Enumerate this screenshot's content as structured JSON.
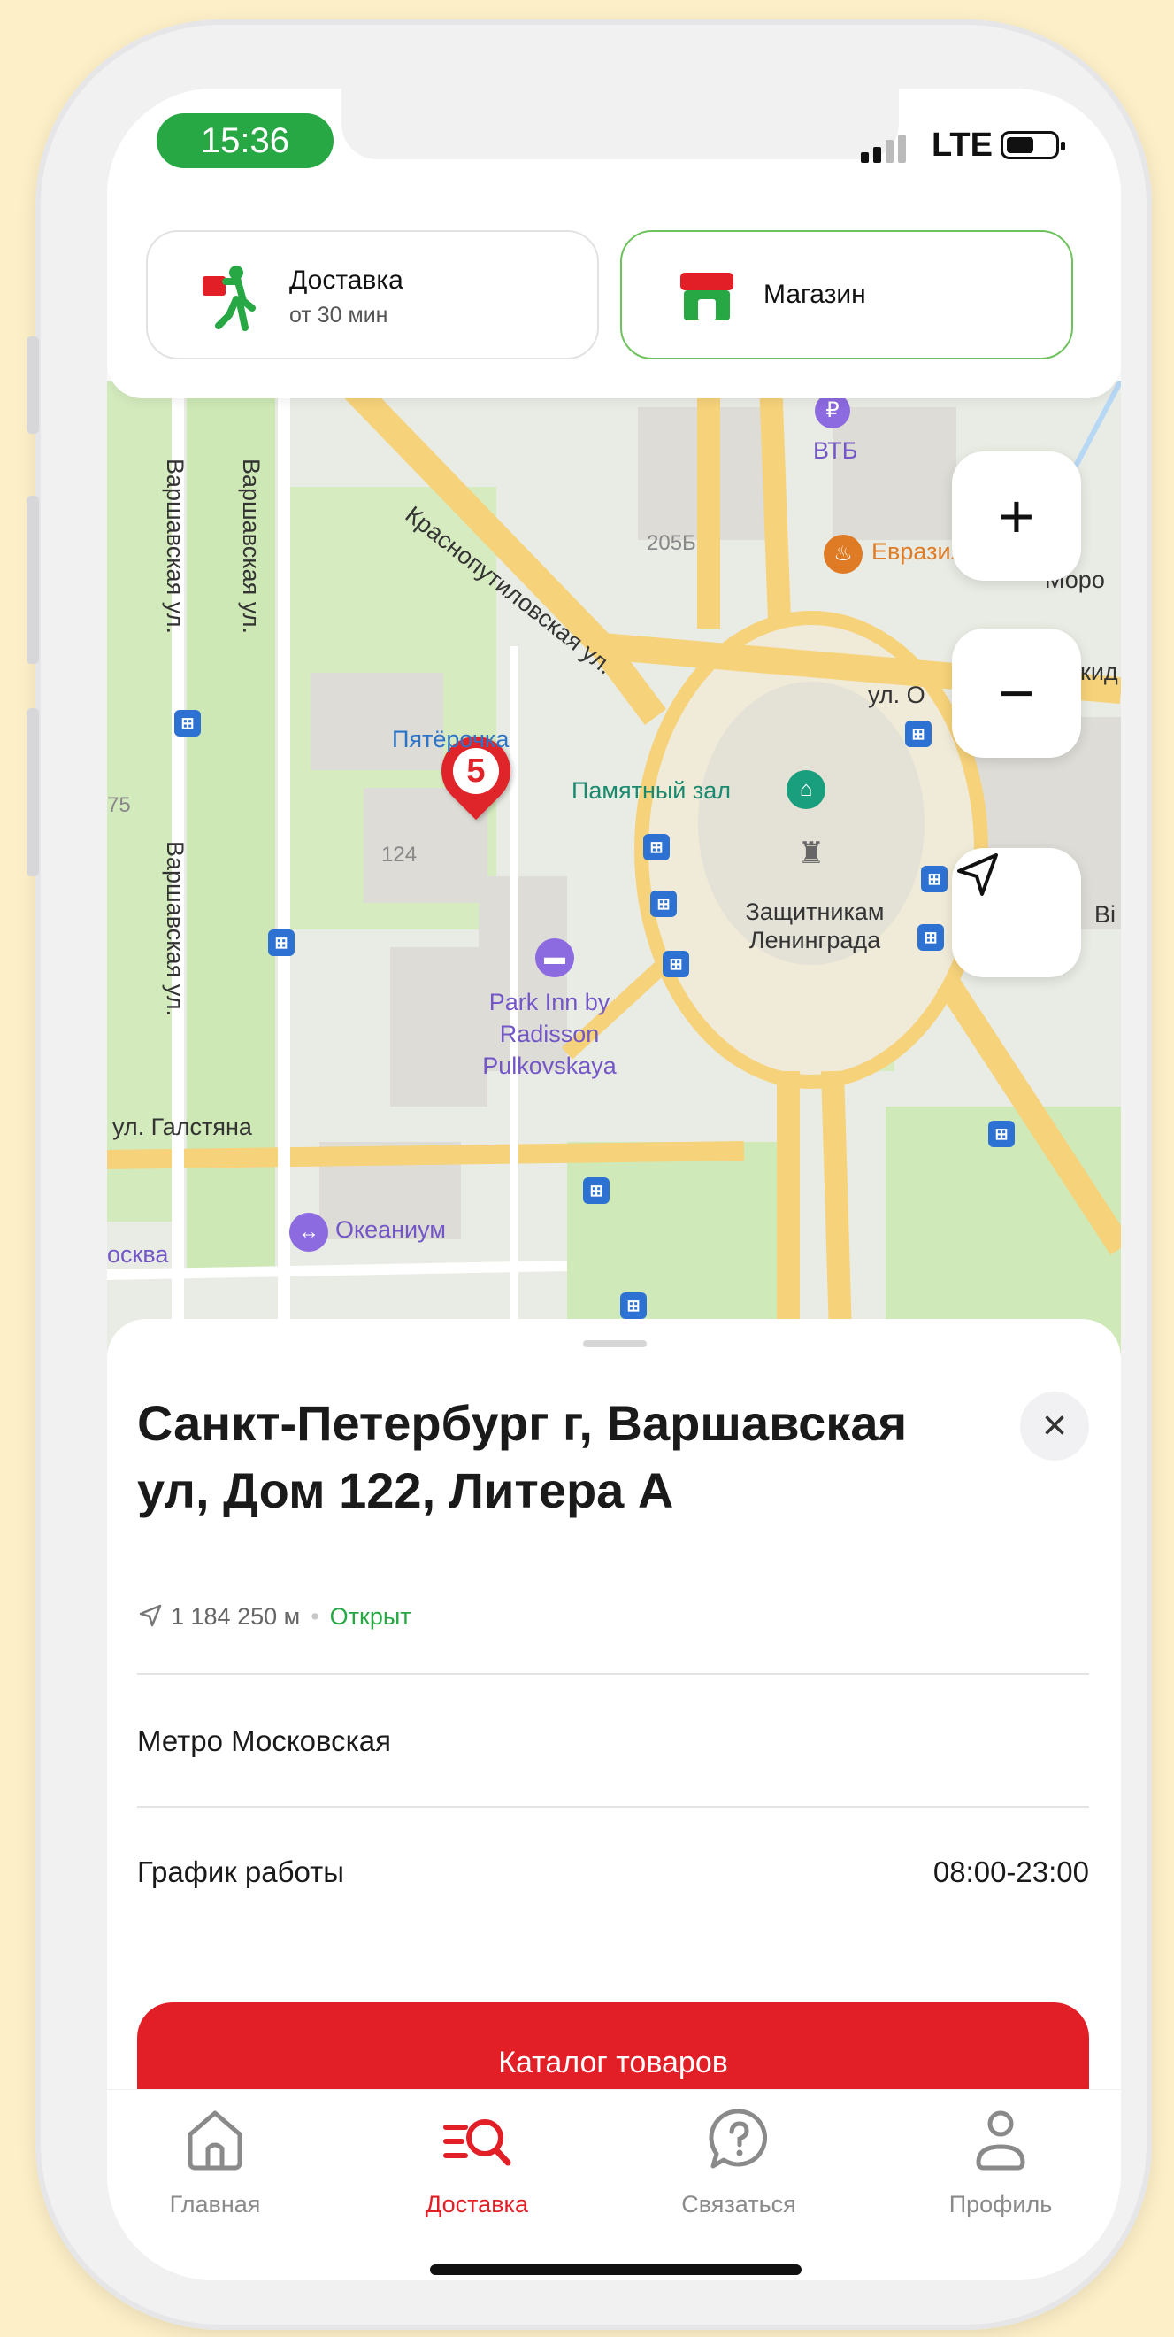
{
  "status_bar": {
    "time": "15:36",
    "network": "LTE"
  },
  "mode_tabs": {
    "delivery": {
      "title": "Доставка",
      "subtitle": "от 30 мин"
    },
    "store": {
      "title": "Магазин"
    }
  },
  "map": {
    "streets": {
      "krasnoputilovskaya": "Краснопутиловская ул.",
      "varshavskaya_1": "Варшавская ул.",
      "varshavskaya_2": "Варшавская ул.",
      "varshavskaya_3": "Варшавская ул.",
      "galstyana": "ул. Галстяна",
      "ul_o": "ул. О"
    },
    "places": {
      "pyaterochka": "Пятёрочка",
      "memorial_hall": "Памятный зал",
      "monument": "Защитникам Ленинграда",
      "hotel": "Park Inn by Radisson Pulkovskaya",
      "vtb": "ВТБ",
      "evrazia": "Евразия",
      "okeanium": "Океаниум",
      "moscow_partial": "осква",
      "moro_partial": "Моро",
      "vi_partial": "Ві",
      "house_205b": "205Б",
      "house_124": "124",
      "house_75": "75",
      "kid_partial": "кид"
    },
    "pin_glyph": "5",
    "controls": {
      "zoom_in": "+",
      "zoom_out": "−"
    }
  },
  "store_sheet": {
    "address": "Санкт-Петербург г, Варшавская ул, Дом 122, Литера А",
    "distance": "1 184 250 м",
    "status": "Открыт",
    "metro": "Метро Московская",
    "schedule_label": "График работы",
    "schedule_value": "08:00-23:00",
    "catalog_button": "Каталог товаров"
  },
  "tab_bar": {
    "items": [
      {
        "label": "Главная",
        "icon": "home-icon"
      },
      {
        "label": "Доставка",
        "icon": "delivery-search-icon",
        "active": true
      },
      {
        "label": "Связаться",
        "icon": "support-chat-icon"
      },
      {
        "label": "Профиль",
        "icon": "profile-icon"
      }
    ]
  },
  "colors": {
    "accent_red": "#e21e26",
    "open_green": "#27a844",
    "store_tab_border": "#6ec25c"
  }
}
